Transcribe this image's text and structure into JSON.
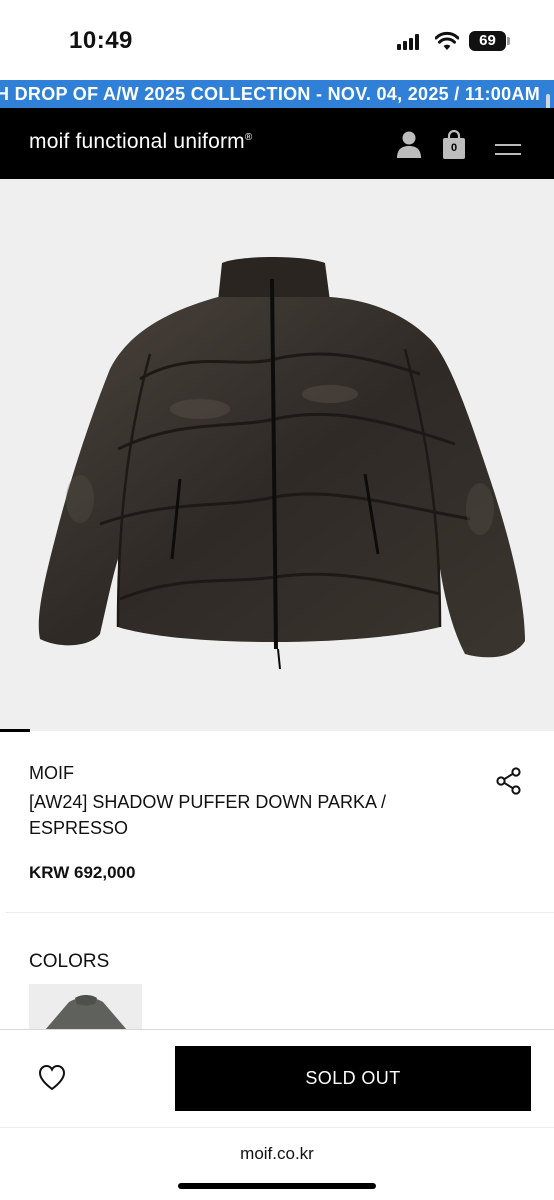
{
  "status_bar": {
    "time": "10:49",
    "battery": "69",
    "icons": [
      "signal-icon",
      "wifi-icon",
      "battery-icon"
    ]
  },
  "announcement": {
    "text": "H DROP OF A/W 2025 COLLECTION - NOV. 04, 2025 / 11:00AM",
    "background": "#2f80d6"
  },
  "header": {
    "brand": "moif functional uniform",
    "brand_mark": "®",
    "cart_count": "0",
    "icons": [
      "user-icon",
      "shopping-bag-icon",
      "menu-icon"
    ]
  },
  "product": {
    "image_alt": "jacket-image",
    "brand": "MOIF",
    "name": "[AW24] SHADOW PUFFER DOWN PARKA / ESPRESSO",
    "price": "KRW 692,000",
    "colors_label": "COLORS"
  },
  "actions": {
    "wish_icon": "heart-icon",
    "soldout_label": "SOLD OUT"
  },
  "browser": {
    "url": "moif.co.kr"
  },
  "colors": {
    "accent": "#2f80d6",
    "header_bg": "#000000",
    "jacket": "#3d3732"
  }
}
